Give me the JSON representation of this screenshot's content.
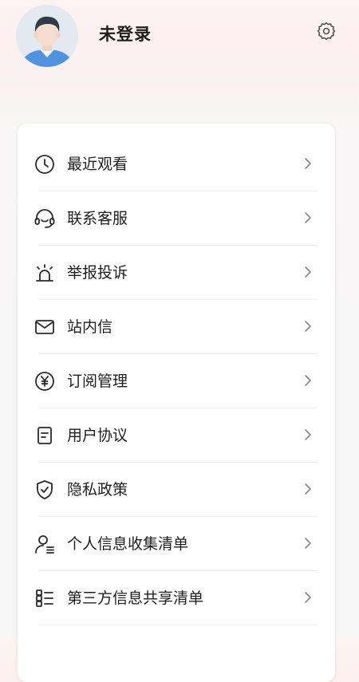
{
  "profile": {
    "username": "未登录"
  },
  "menu": {
    "items": [
      {
        "label": "最近观看",
        "icon": "clock-icon"
      },
      {
        "label": "联系客服",
        "icon": "headset-icon"
      },
      {
        "label": "举报投诉",
        "icon": "alarm-siren-icon"
      },
      {
        "label": "站内信",
        "icon": "mail-icon"
      },
      {
        "label": "订阅管理",
        "icon": "yen-circle-icon"
      },
      {
        "label": "用户协议",
        "icon": "document-icon"
      },
      {
        "label": "隐私政策",
        "icon": "shield-check-icon"
      },
      {
        "label": "个人信息收集清单",
        "icon": "user-list-icon"
      },
      {
        "label": "第三方信息共享清单",
        "icon": "grid-list-icon"
      }
    ]
  },
  "colors": {
    "text": "#1e1e1e",
    "icon_stroke": "#2a2a2a",
    "card": "#ffffff",
    "background_top": "#fdf3f2"
  }
}
